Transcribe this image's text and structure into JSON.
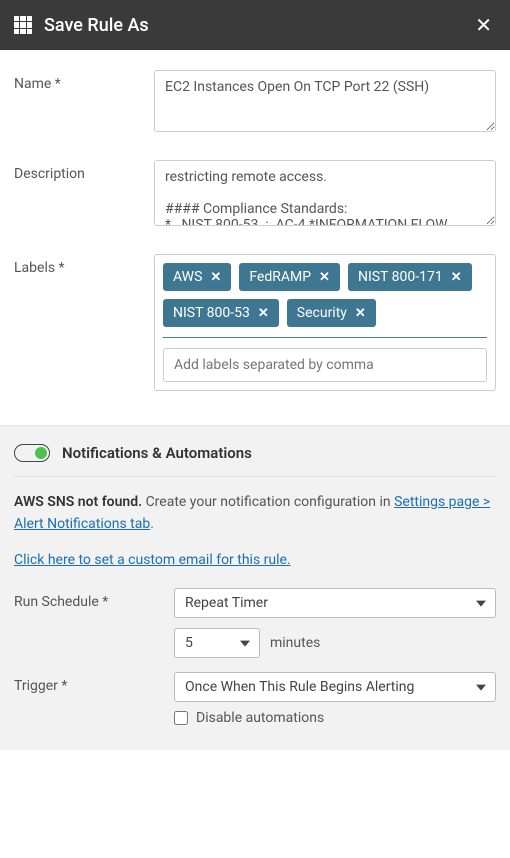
{
  "header": {
    "title": "Save Rule As"
  },
  "form": {
    "name_label": "Name *",
    "name_value": "EC2 Instances Open On TCP Port 22 (SSH)",
    "description_label": "Description",
    "description_value": "restricting remote access.\n\n#### Compliance Standards:\n*   NIST 800-53  :  AC-4 *INFORMATION FLOW",
    "labels_label": "Labels *",
    "labels": [
      "AWS",
      "FedRAMP",
      "NIST 800-171",
      "NIST 800-53",
      "Security"
    ],
    "labels_placeholder": "Add labels separated by comma"
  },
  "notifications": {
    "section_title": "Notifications & Automations",
    "notice_strong": "AWS SNS not found.",
    "notice_rest": " Create your notification configuration in ",
    "notice_link": "Settings page > Alert Notifications tab",
    "notice_period": ".",
    "custom_email_link": "Click here to set a custom email for this rule.",
    "run_schedule_label": "Run Schedule *",
    "run_schedule_value": "Repeat Timer",
    "interval_value": "5",
    "interval_unit": "minutes",
    "trigger_label": "Trigger *",
    "trigger_value": "Once When This Rule Begins Alerting",
    "disable_label": "Disable automations"
  }
}
